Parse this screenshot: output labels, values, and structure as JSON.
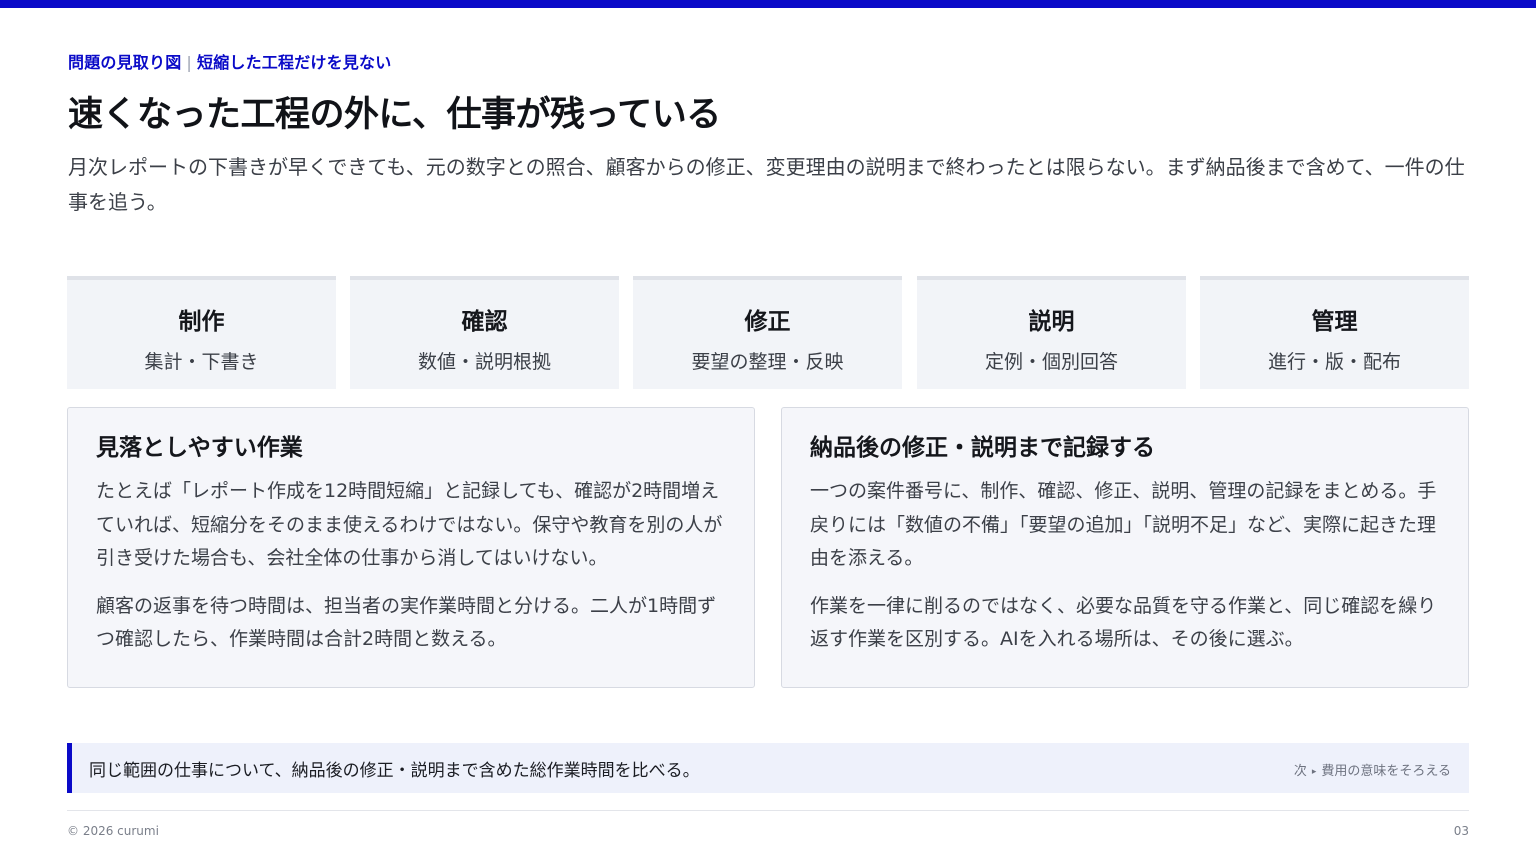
{
  "colors": {
    "accent": "#0a0ac8",
    "step_bg": "#f2f4f8",
    "card_bg": "#f5f6fa",
    "note_bg": "#eef1fb"
  },
  "eyebrow": {
    "left": "問題の見取り図",
    "separator": "|",
    "right": "短縮した工程だけを見ない"
  },
  "title": "速くなった工程の外に、仕事が残っている",
  "lead": "月次レポートの下書きが早くできても、元の数字との照合、顧客からの修正、変更理由の説明まで終わったとは限らない。まず納品後まで含めて、一件の仕事を追う。",
  "steps": [
    {
      "name": "制作",
      "desc": "集計・下書き"
    },
    {
      "name": "確認",
      "desc": "数値・説明根拠"
    },
    {
      "name": "修正",
      "desc": "要望の整理・反映"
    },
    {
      "name": "説明",
      "desc": "定例・個別回答"
    },
    {
      "name": "管理",
      "desc": "進行・版・配布"
    }
  ],
  "cards": [
    {
      "title": "見落としやすい作業",
      "paragraphs": [
        "たとえば「レポート作成を12時間短縮」と記録しても、確認が2時間増えていれば、短縮分をそのまま使えるわけではない。保守や教育を別の人が引き受けた場合も、会社全体の仕事から消してはいけない。",
        "顧客の返事を待つ時間は、担当者の実作業時間と分ける。二人が1時間ずつ確認したら、作業時間は合計2時間と数える。"
      ]
    },
    {
      "title": "納品後の修正・説明まで記録する",
      "paragraphs": [
        "一つの案件番号に、制作、確認、修正、説明、管理の記録をまとめる。手戻りには「数値の不備」「要望の追加」「説明不足」など、実際に起きた理由を添える。",
        "作業を一律に削るのではなく、必要な品質を守る作業と、同じ確認を繰り返す作業を区別する。AIを入れる場所は、その後に選ぶ。"
      ]
    }
  ],
  "note": {
    "text": "同じ範囲の仕事について、納品後の修正・説明まで含めた総作業時間を比べる。",
    "next_label": "次",
    "next_arrow": "▸",
    "next_title": "費用の意味をそろえる"
  },
  "footer": {
    "copyright": "© 2026 curumi",
    "page": "03"
  }
}
